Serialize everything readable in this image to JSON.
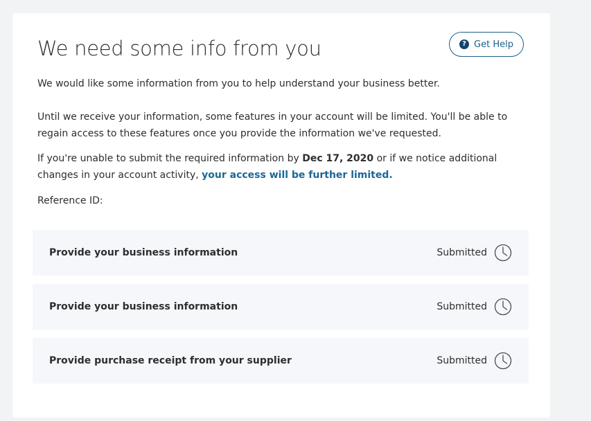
{
  "header": {
    "title": "We need some info from you",
    "help_label": "Get Help",
    "help_icon": "question-circle-icon"
  },
  "intro": {
    "line1": "We would like some information from you to help understand your business better.",
    "line2": "Until we receive your information, some features in your account will be limited. You'll be able to regain access to these features once you provide the information we've requested.",
    "line3_before": "If you're unable to submit the required information by ",
    "line3_date": "Dec 17, 2020",
    "line3_middle": " or if we notice additional changes in your account activity, ",
    "line3_link": "your access will be further limited.",
    "reference_label": "Reference ID:"
  },
  "tasks": [
    {
      "label": "Provide your business information",
      "status": "Submitted",
      "icon": "clock-icon"
    },
    {
      "label": "Provide your business information",
      "status": "Submitted",
      "icon": "clock-icon"
    },
    {
      "label": "Provide purchase receipt from your supplier",
      "status": "Submitted",
      "icon": "clock-icon"
    }
  ],
  "colors": {
    "accent": "#1a6897",
    "button_border": "#1c5f8a",
    "task_background": "#f5f7fa",
    "page_background": "#f2f3f4"
  }
}
